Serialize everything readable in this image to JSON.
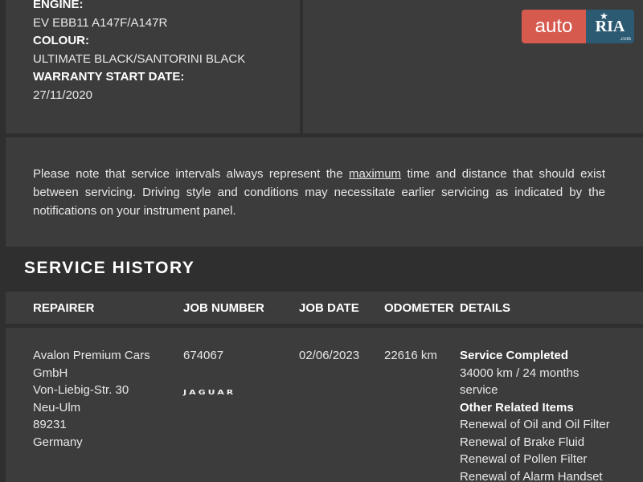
{
  "vehicle": {
    "engine_label": "ENGINE:",
    "engine_value": "EV EBB11 A147F/A147R",
    "colour_label": "COLOUR:",
    "colour_value": "ULTIMATE BLACK/SANTORINI BLACK",
    "warranty_label": "WARRANTY START DATE:",
    "warranty_value": "27/11/2020"
  },
  "notice": {
    "before": "Please note that service intervals always represent the ",
    "emphasis": "maximum",
    "after": " time and distance that should exist between servicing. Driving style and conditions may necessitate earlier servicing as indicated by the notifications on your instrument panel."
  },
  "service_history": {
    "title": "SERVICE HISTORY",
    "columns": [
      "REPAIRER",
      "JOB NUMBER",
      "JOB DATE",
      "ODOMETER",
      "DETAILS"
    ],
    "rows": [
      {
        "repairer": [
          "Avalon Premium Cars",
          "GmbH",
          "Von-Liebig-Str. 30",
          "Neu-Ulm",
          "89231",
          "Germany"
        ],
        "job_number": "674067",
        "brand": "JAGUAR",
        "job_date": "02/06/2023",
        "odometer": "22616 km",
        "details_heading": "Service Completed",
        "details_interval": [
          "34000 km / 24 months",
          "service"
        ],
        "related_heading": "Other Related Items",
        "related_items": [
          "Renewal of Oil and Oil Filter",
          "Renewal of Brake Fluid",
          "Renewal of Pollen Filter",
          "Renewal of Alarm Handset"
        ]
      }
    ]
  },
  "watermark": {
    "left_text": "auto",
    "right_text": "RIA",
    "domain": ".com",
    "colors": {
      "left": "#d75a4f",
      "right": "#2b5a72"
    }
  },
  "colors": {
    "background": "#2f2f2f",
    "card": "#3c3c3c",
    "text": "#e8e8e8"
  }
}
